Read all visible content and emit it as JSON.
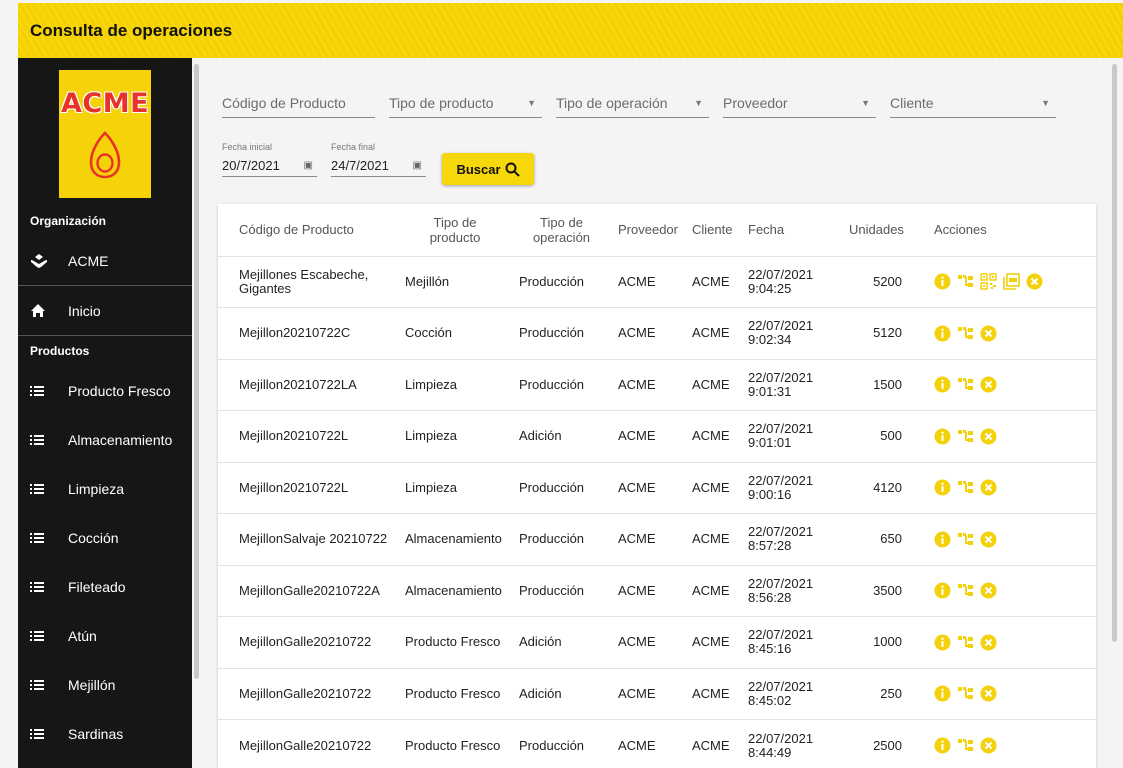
{
  "header": {
    "title": "Consulta de operaciones"
  },
  "sidebar": {
    "logo_text": "ACME",
    "org_header": "Organización",
    "org_name": "ACME",
    "home_label": "Inicio",
    "products_header": "Productos",
    "items": [
      {
        "label": "Producto Fresco"
      },
      {
        "label": "Almacenamiento"
      },
      {
        "label": "Limpieza"
      },
      {
        "label": "Cocción"
      },
      {
        "label": "Fileteado"
      },
      {
        "label": "Atún"
      },
      {
        "label": "Mejillón"
      },
      {
        "label": "Sardinas"
      }
    ]
  },
  "filters": {
    "codigo_placeholder": "Código de Producto",
    "tipo_producto_placeholder": "Tipo de producto",
    "tipo_operacion_placeholder": "Tipo de operación",
    "proveedor_placeholder": "Proveedor",
    "cliente_placeholder": "Cliente",
    "fecha_inicial_label": "Fecha inicial",
    "fecha_inicial_value": "20/7/2021",
    "fecha_final_label": "Fecha final",
    "fecha_final_value": "24/7/2021",
    "buscar_label": "Buscar"
  },
  "table": {
    "headers": {
      "codigo": "Código de Producto",
      "tipo_producto_1": "Tipo de",
      "tipo_producto_2": "producto",
      "tipo_operacion_1": "Tipo de",
      "tipo_operacion_2": "operación",
      "proveedor": "Proveedor",
      "cliente": "Cliente",
      "fecha": "Fecha",
      "unidades": "Unidades",
      "acciones": "Acciones"
    },
    "rows": [
      {
        "codigo_1": "Mejillones Escabeche,",
        "codigo_2": "Gigantes",
        "tipo_producto": "Mejillón",
        "tipo_operacion": "Producción",
        "proveedor": "ACME",
        "cliente": "ACME",
        "fecha": "22/07/2021",
        "hora": "9:04:25",
        "unidades": "5200",
        "extra_actions": true
      },
      {
        "codigo_1": "Mejillon20210722C",
        "codigo_2": "",
        "tipo_producto": "Cocción",
        "tipo_operacion": "Producción",
        "proveedor": "ACME",
        "cliente": "ACME",
        "fecha": "22/07/2021",
        "hora": "9:02:34",
        "unidades": "5120",
        "extra_actions": false
      },
      {
        "codigo_1": "Mejillon20210722LA",
        "codigo_2": "",
        "tipo_producto": "Limpieza",
        "tipo_operacion": "Producción",
        "proveedor": "ACME",
        "cliente": "ACME",
        "fecha": "22/07/2021",
        "hora": "9:01:31",
        "unidades": "1500",
        "extra_actions": false
      },
      {
        "codigo_1": "Mejillon20210722L",
        "codigo_2": "",
        "tipo_producto": "Limpieza",
        "tipo_operacion": "Adición",
        "proveedor": "ACME",
        "cliente": "ACME",
        "fecha": "22/07/2021",
        "hora": "9:01:01",
        "unidades": "500",
        "extra_actions": false
      },
      {
        "codigo_1": "Mejillon20210722L",
        "codigo_2": "",
        "tipo_producto": "Limpieza",
        "tipo_operacion": "Producción",
        "proveedor": "ACME",
        "cliente": "ACME",
        "fecha": "22/07/2021",
        "hora": "9:00:16",
        "unidades": "4120",
        "extra_actions": false
      },
      {
        "codigo_1": "MejillonSalvaje 20210722",
        "codigo_2": "",
        "tipo_producto": "Almacenamiento",
        "tipo_operacion": "Producción",
        "proveedor": "ACME",
        "cliente": "ACME",
        "fecha": "22/07/2021",
        "hora": "8:57:28",
        "unidades": "650",
        "extra_actions": false
      },
      {
        "codigo_1": "MejillonGalle20210722A",
        "codigo_2": "",
        "tipo_producto": "Almacenamiento",
        "tipo_operacion": "Producción",
        "proveedor": "ACME",
        "cliente": "ACME",
        "fecha": "22/07/2021",
        "hora": "8:56:28",
        "unidades": "3500",
        "extra_actions": false
      },
      {
        "codigo_1": "MejillonGalle20210722",
        "codigo_2": "",
        "tipo_producto": "Producto Fresco",
        "tipo_operacion": "Adición",
        "proveedor": "ACME",
        "cliente": "ACME",
        "fecha": "22/07/2021",
        "hora": "8:45:16",
        "unidades": "1000",
        "extra_actions": false
      },
      {
        "codigo_1": "MejillonGalle20210722",
        "codigo_2": "",
        "tipo_producto": "Producto Fresco",
        "tipo_operacion": "Adición",
        "proveedor": "ACME",
        "cliente": "ACME",
        "fecha": "22/07/2021",
        "hora": "8:45:02",
        "unidades": "250",
        "extra_actions": false
      },
      {
        "codigo_1": "MejillonGalle20210722",
        "codigo_2": "",
        "tipo_producto": "Producto Fresco",
        "tipo_operacion": "Producción",
        "proveedor": "ACME",
        "cliente": "ACME",
        "fecha": "22/07/2021",
        "hora": "8:44:49",
        "unidades": "2500",
        "extra_actions": false
      }
    ]
  },
  "colors": {
    "accent": "#f6d70a",
    "sidebar_bg": "#161616",
    "logo_red": "#e8332a"
  },
  "icons": {
    "org": "hand-holding-icon",
    "home": "home-icon",
    "list": "list-icon",
    "search": "search-icon",
    "calendar": "calendar-icon",
    "info": "info-icon",
    "tree": "tree-icon",
    "qr": "qr-code-icon",
    "pdf": "pdf-icon",
    "cancel": "cancel-icon"
  }
}
